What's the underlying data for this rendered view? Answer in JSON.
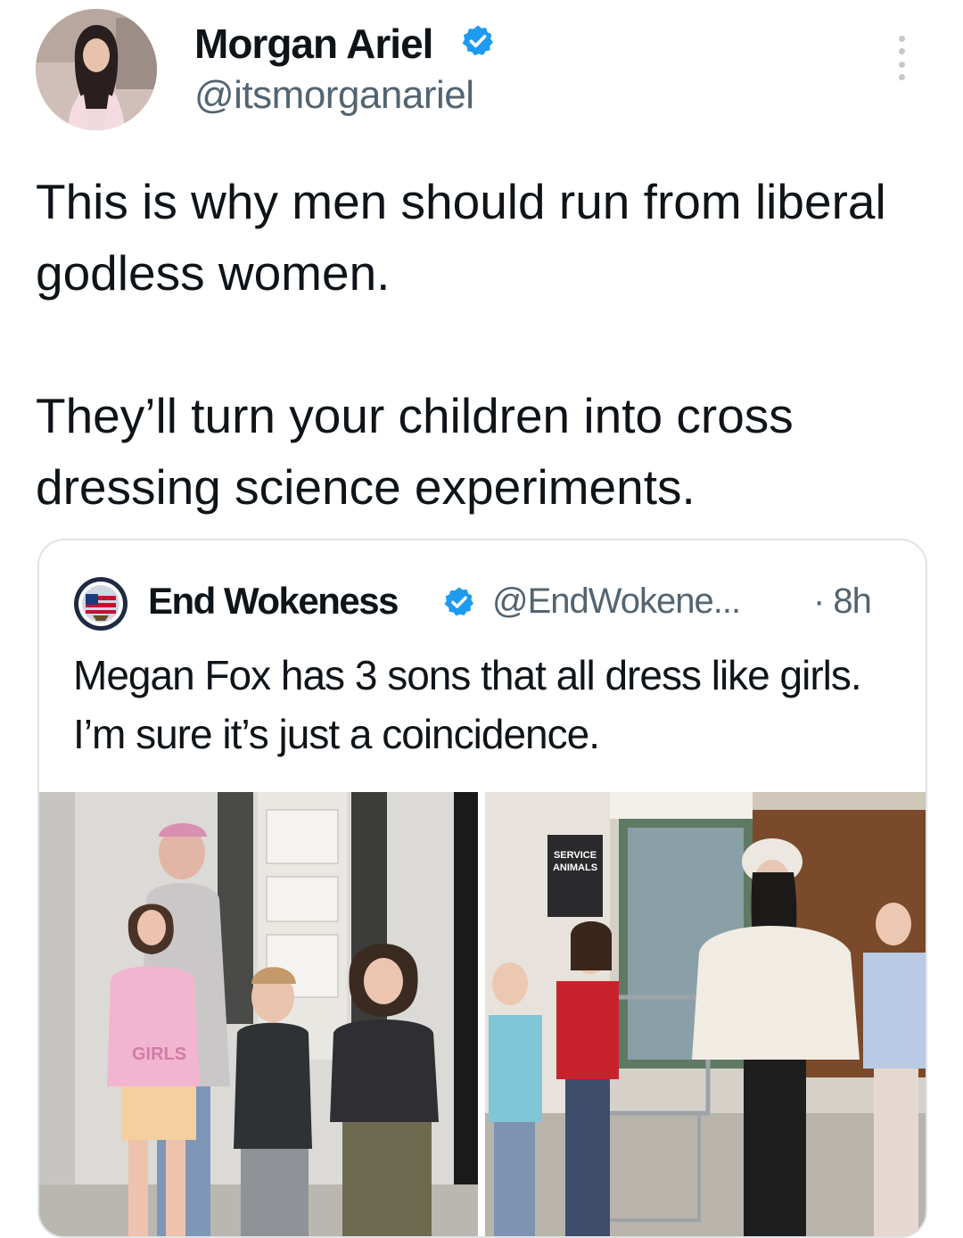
{
  "tweet": {
    "author": {
      "display_name": "Morgan Ariel",
      "handle": "@itsmorganariel",
      "verified": true
    },
    "body": [
      "This is why men should run from liberal godless women.",
      "They’ll turn your children into cross dressing science experiments."
    ]
  },
  "quoted_tweet": {
    "author": {
      "display_name": "End Wokeness",
      "handle": "@EndWokene...",
      "verified": true
    },
    "time": "· 8h",
    "text": "Megan Fox has 3 sons that all dress like girls. I’m sure it’s just a coincidence.",
    "media": {
      "left_photo": {
        "shirt_text": "GIRLS"
      },
      "right_photo": {
        "sign_text": [
          "SERVICE",
          "ANIMALS"
        ]
      }
    }
  },
  "colors": {
    "verified_badge": "#1d9bf0",
    "text_primary": "#0f1419",
    "text_secondary": "#536471",
    "border": "#dfe3e6"
  },
  "icons": [
    "verified-badge-icon",
    "more-options-icon"
  ]
}
